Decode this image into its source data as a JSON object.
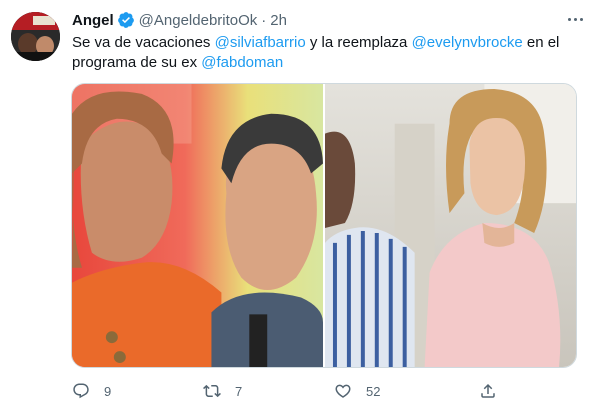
{
  "tweet": {
    "author": {
      "display_name": "Angel",
      "verified": true,
      "handle": "@AngeldebritoOk",
      "separator": "·",
      "time": "2h"
    },
    "text": {
      "line1_prefix": "Se va de vacaciones ",
      "mention1": "@silviafbarrio",
      "line1_mid": " y la reemplaza ",
      "mention2": "@evelynvbrocke",
      "line1_suffix": " en el",
      "line2_prefix": "programa de su ex ",
      "mention3": "@fabdoman"
    },
    "media": {
      "images": [
        {
          "icon": "photo-left-woman-and-man-tv-studio"
        },
        {
          "icon": "photo-right-woman-pink-dress"
        }
      ]
    },
    "actions": {
      "reply_count": "9",
      "retweet_count": "7",
      "like_count": "52",
      "reply_icon": "reply-icon",
      "retweet_icon": "retweet-icon",
      "like_icon": "heart-icon",
      "share_icon": "share-icon"
    }
  },
  "colors": {
    "accent": "#1d9bf0",
    "text": "#0f1419",
    "secondary": "#536471"
  }
}
